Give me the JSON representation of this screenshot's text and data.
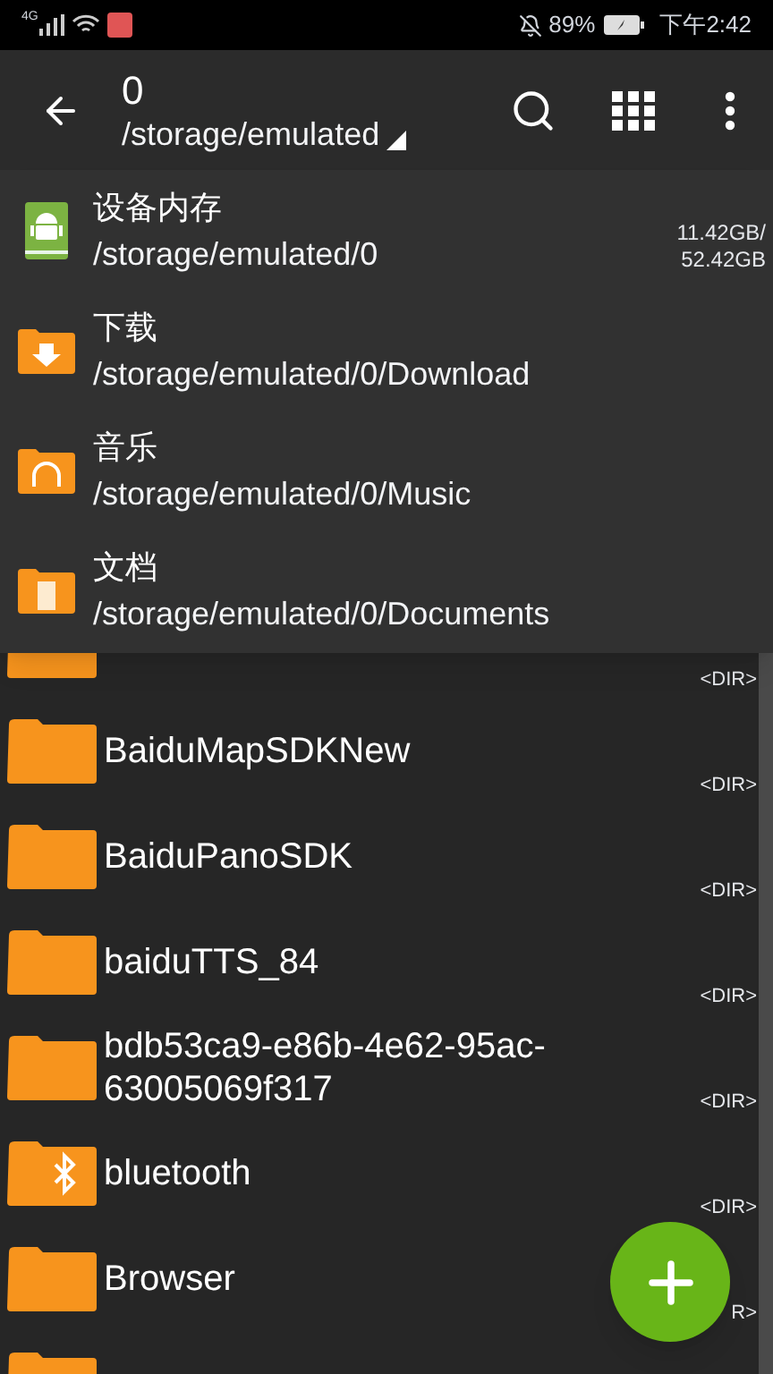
{
  "status_bar": {
    "network": "4G",
    "battery": "89%",
    "time": "下午2:42"
  },
  "toolbar": {
    "title": "0",
    "path": "/storage/emulated"
  },
  "dropdown": [
    {
      "kind": "device",
      "name": "设备内存",
      "path": "/storage/emulated/0",
      "usage": "11.42GB/",
      "total": "52.42GB"
    },
    {
      "kind": "download",
      "name": "下载",
      "path": "/storage/emulated/0/Download"
    },
    {
      "kind": "music",
      "name": "音乐",
      "path": "/storage/emulated/0/Music"
    },
    {
      "kind": "documents",
      "name": "文档",
      "path": "/storage/emulated/0/Documents"
    }
  ],
  "files": [
    {
      "kind": "folder",
      "type": "<DIR>"
    },
    {
      "kind": "folder",
      "name": "BaiduMapSDKNew",
      "type": "<DIR>"
    },
    {
      "kind": "folder",
      "name": "BaiduPanoSDK",
      "type": "<DIR>"
    },
    {
      "kind": "folder",
      "name": "baiduTTS_84",
      "type": "<DIR>"
    },
    {
      "kind": "folder",
      "name": "bdb53ca9-e86b-4e62-95ac-63005069f317",
      "type": "<DIR>"
    },
    {
      "kind": "bluetooth",
      "name": "bluetooth",
      "type": "<DIR>"
    },
    {
      "kind": "folder",
      "name": "Browser",
      "type": "R>"
    },
    {
      "kind": "folder"
    }
  ]
}
